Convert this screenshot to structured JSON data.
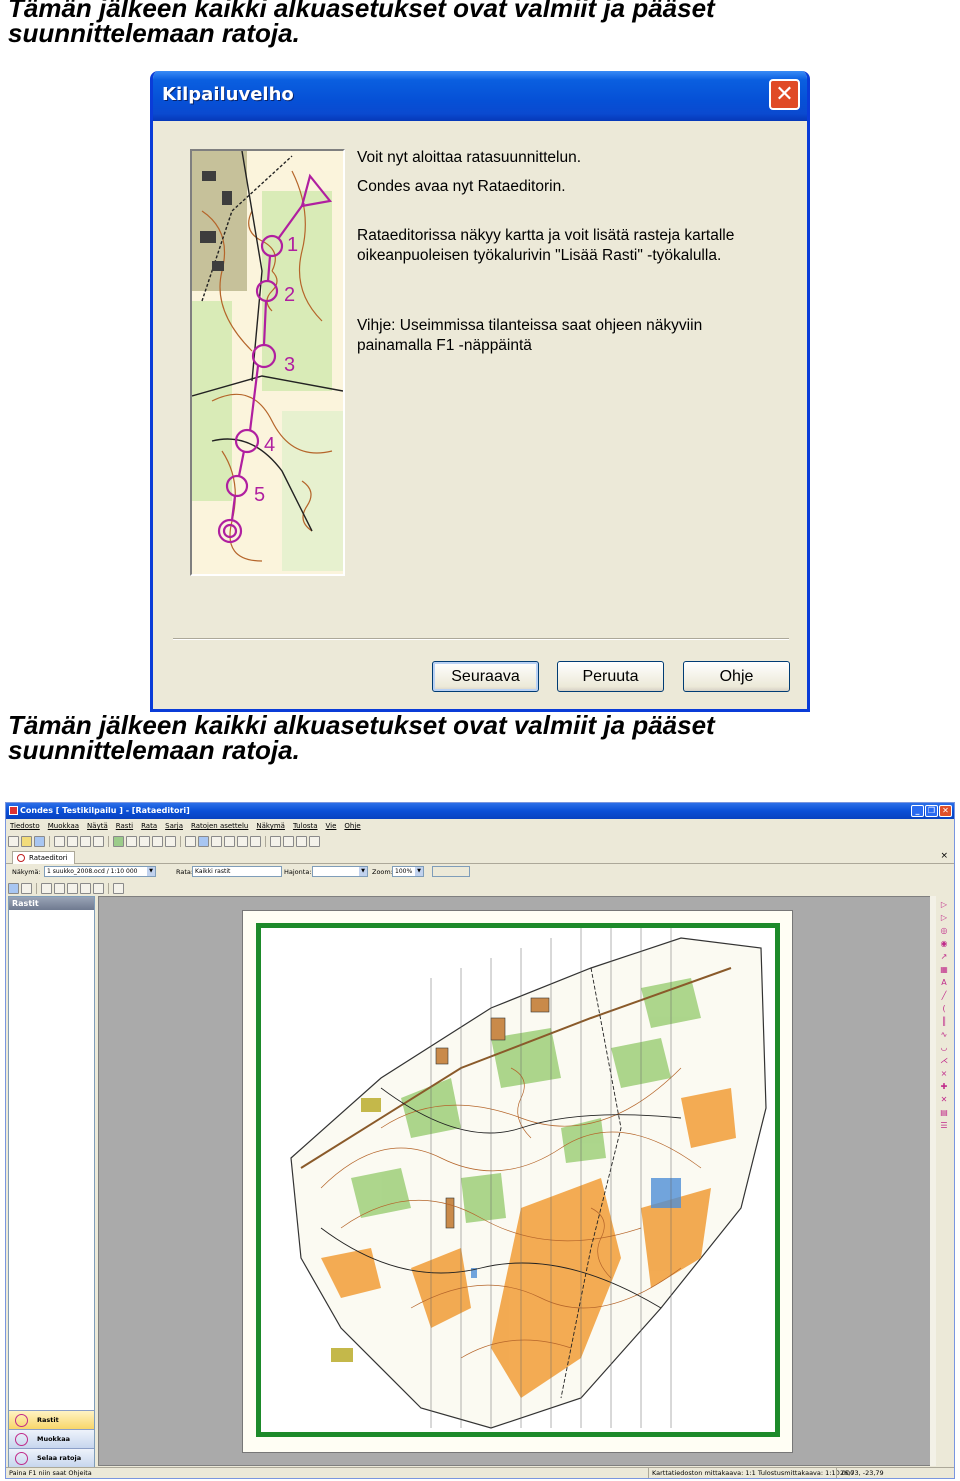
{
  "captions": {
    "top": {
      "line1": "Tämän jälkeen kaikki alkuasetukset ovat valmiit ja pääset",
      "line2": "suunnittelemaan ratoja."
    },
    "middle": {
      "line1": "Tämän jälkeen kaikki alkuasetukset ovat valmiit ja pääset",
      "line2": "suunnittelemaan ratoja."
    }
  },
  "wizard": {
    "title": "Kilpailuvelho",
    "close_symbol": "✕",
    "text": {
      "line1": "Voit nyt aloittaa ratasuunnittelun.",
      "line2": "Condes avaa nyt Rataeditorin.",
      "line3": "Rataeditorissa näkyy kartta ja voit lisätä rasteja kartalle",
      "line4": "oikeanpuoleisen työkalurivin \"Lisää Rasti\" -työkalulla.",
      "line5": "Vihje: Useimmissa tilanteissa saat ohjeen näkyviin",
      "line6": "painamalla F1 -näppäintä"
    },
    "map_labels": [
      "1",
      "2",
      "3",
      "4",
      "5"
    ],
    "buttons": {
      "next": "Seuraava",
      "cancel": "Peruuta",
      "help": "Ohje"
    }
  },
  "app": {
    "title": "Condes [ Testikilpailu ] - [Rataeditori]",
    "window_buttons": {
      "minimize": "_",
      "restore": "❐",
      "close": "✕"
    },
    "menu": [
      "Tiedosto",
      "Muokkaa",
      "Näytä",
      "Rasti",
      "Rata",
      "Sarja",
      "Ratojen asettelu",
      "Näkymä",
      "Tulosta",
      "Vie",
      "Ohje"
    ],
    "doc_tab": "Rataeditori",
    "doc_close": "×",
    "selectors": {
      "view_label": "Näkymä:",
      "view_value": "1 suukko_2008.ocd  / 1:10 000",
      "course_label": "Rata:",
      "course_value": "Kaikki rastit",
      "spread_label": "Hajonta:",
      "spread_value": "",
      "zoom_label": "Zoom:",
      "zoom_value": "100%"
    },
    "left_panel": {
      "header": "Rastit",
      "nav": [
        "Rastit",
        "Muokkaa ratoja",
        "Selaa ratoja"
      ]
    },
    "statusbar": {
      "hint": "Paina F1 niin saat Ohjeita",
      "scale": "Karttatiedoston mittakaava: 1:1 Tulostusmittakaava: 1:10 000",
      "coords": "26,73, -23,79"
    },
    "colors": {
      "map_frame": "#1d8a2a",
      "forest": "#ffffff",
      "open_land": "#f2a64a",
      "green": "#9fcf7a",
      "control": "#c02a8a"
    }
  }
}
